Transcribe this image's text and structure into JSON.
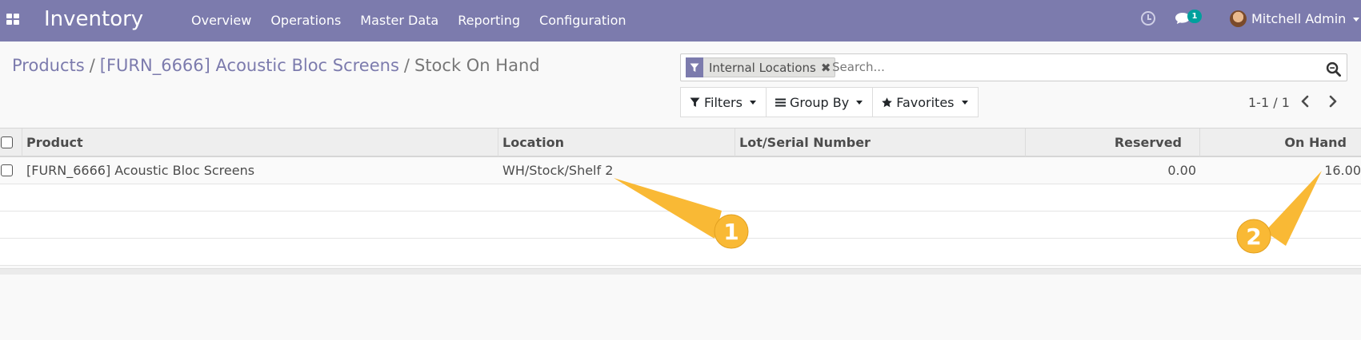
{
  "navbar": {
    "app_name": "Inventory",
    "menu": [
      "Overview",
      "Operations",
      "Master Data",
      "Reporting",
      "Configuration"
    ],
    "chat_badge": "1",
    "user_name": "Mitchell Admin"
  },
  "breadcrumb": {
    "items": [
      "Products",
      "[FURN_6666] Acoustic Bloc Screens"
    ],
    "separator": "/",
    "current": "Stock On Hand"
  },
  "search": {
    "facet": "Internal Locations",
    "facet_remove": "✖",
    "placeholder": "Search..."
  },
  "toolbar": {
    "filters": "Filters",
    "group_by": "Group By",
    "favorites": "Favorites"
  },
  "pager": {
    "value": "1-1 / 1"
  },
  "table": {
    "columns": [
      "Product",
      "Location",
      "Lot/Serial Number",
      "Reserved",
      "On Hand"
    ],
    "rows": [
      {
        "product": "[FURN_6666] Acoustic Bloc Screens",
        "location": "WH/Stock/Shelf 2",
        "lot": "",
        "reserved": "0.00",
        "on_hand": "16.00"
      }
    ]
  },
  "callouts": [
    "1",
    "2"
  ],
  "colors": {
    "navbar": "#7c7bad",
    "callout": "#f9b935",
    "badge": "#00a09d"
  }
}
